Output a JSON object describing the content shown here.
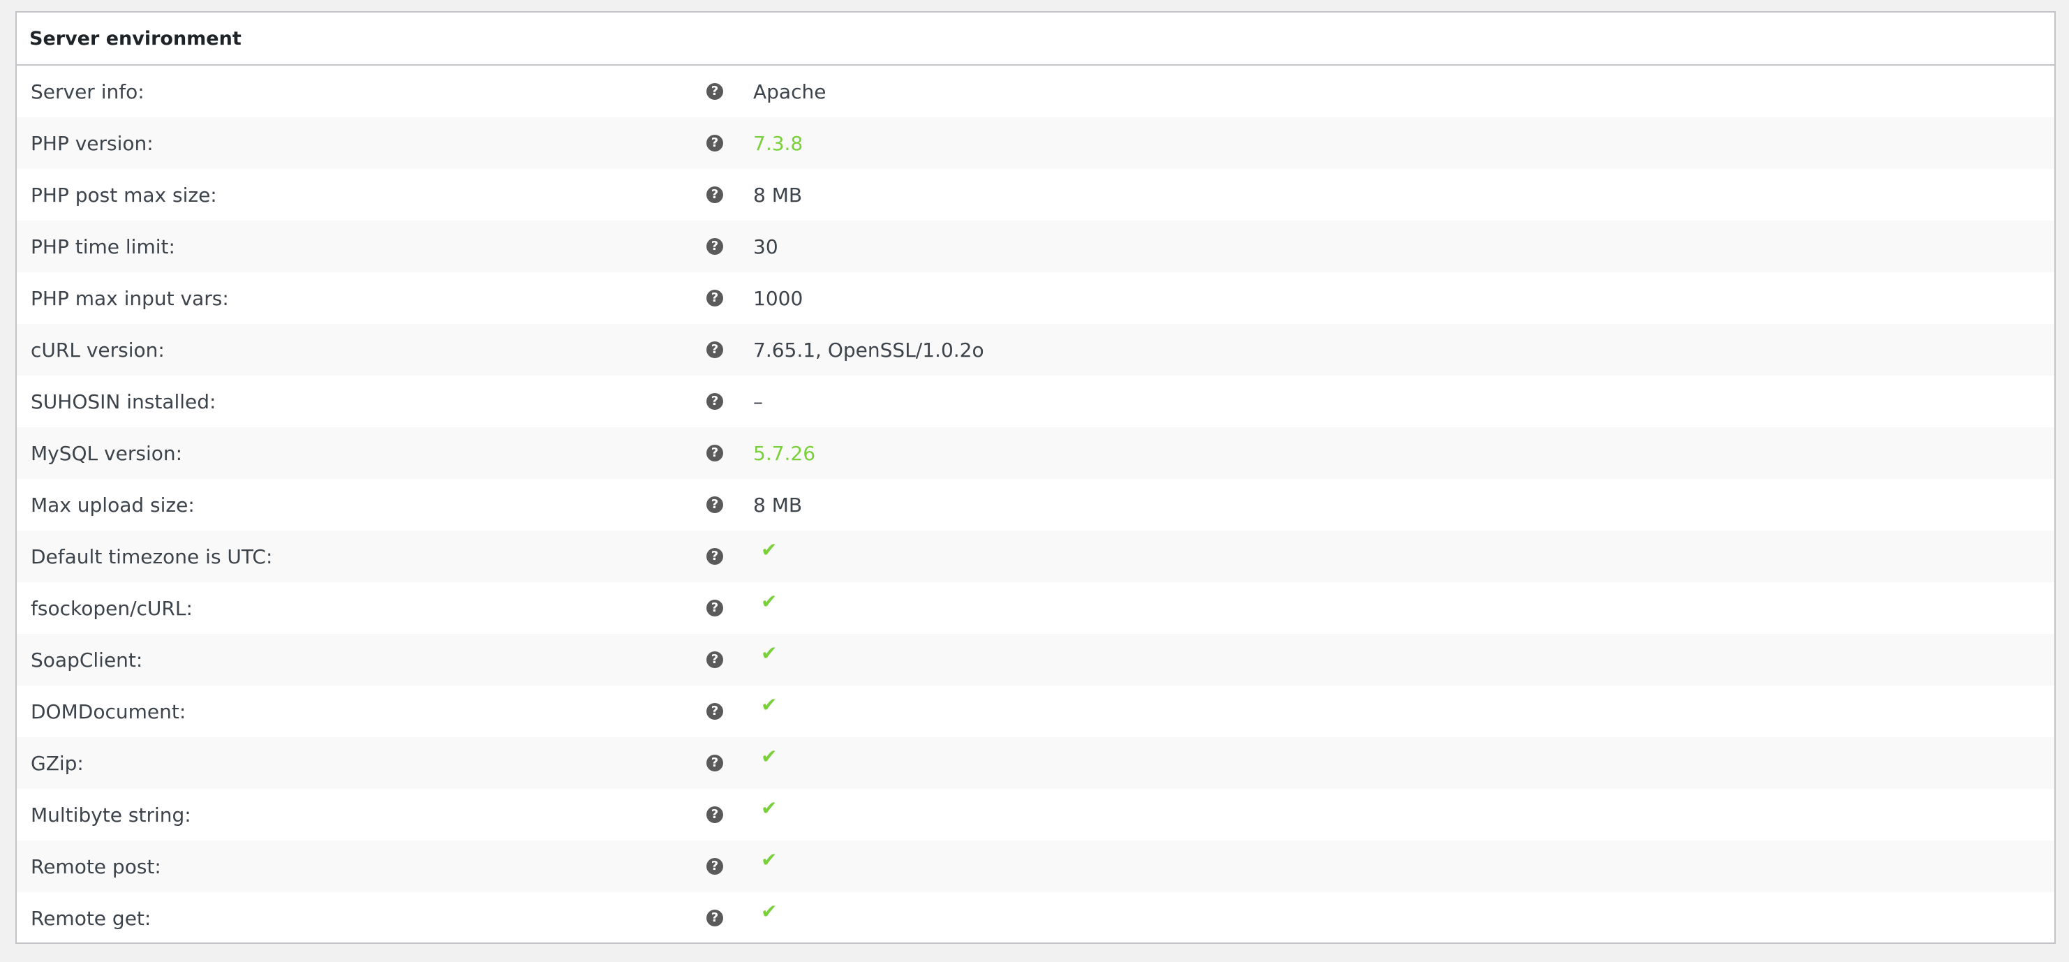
{
  "panel": {
    "title": "Server environment"
  },
  "colors": {
    "ok": "#7ad03a",
    "text": "#3c434a",
    "help_icon": "#5a5a5a"
  },
  "icons": {
    "help": "help-circle-icon",
    "yes": "checkmark-icon"
  },
  "rows": [
    {
      "label": "Server info:",
      "value": "Apache"
    },
    {
      "label": "PHP version:",
      "value": "7.3.8",
      "status": "ok"
    },
    {
      "label": "PHP post max size:",
      "value": "8 MB"
    },
    {
      "label": "PHP time limit:",
      "value": "30"
    },
    {
      "label": "PHP max input vars:",
      "value": "1000"
    },
    {
      "label": "cURL version:",
      "value": "7.65.1, OpenSSL/1.0.2o"
    },
    {
      "label": "SUHOSIN installed:",
      "value": "–"
    },
    {
      "label": "MySQL version:",
      "value": "5.7.26",
      "status": "ok"
    },
    {
      "label": "Max upload size:",
      "value": "8 MB"
    },
    {
      "label": "Default timezone is UTC:",
      "value": "✔"
    },
    {
      "label": "fsockopen/cURL:",
      "value": "✔"
    },
    {
      "label": "SoapClient:",
      "value": "✔"
    },
    {
      "label": "DOMDocument:",
      "value": "✔"
    },
    {
      "label": "GZip:",
      "value": "✔"
    },
    {
      "label": "Multibyte string:",
      "value": "✔"
    },
    {
      "label": "Remote post:",
      "value": "✔"
    },
    {
      "label": "Remote get:",
      "value": "✔"
    }
  ],
  "help_glyph": "?"
}
